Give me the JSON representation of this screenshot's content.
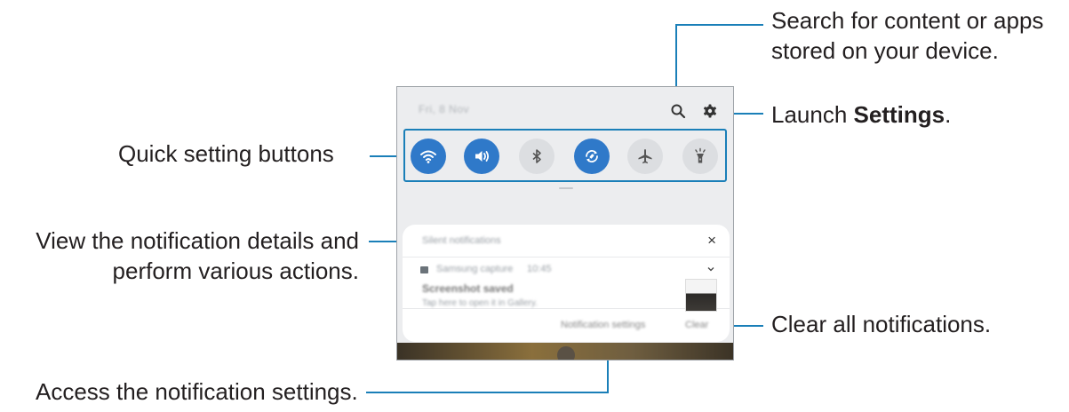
{
  "callouts": {
    "search_line1": "Search for content or apps",
    "search_line2": "stored on your device.",
    "settings_prefix": "Launch ",
    "settings_bold": "Settings",
    "settings_suffix": ".",
    "quick_settings": "Quick setting buttons",
    "notif_details_line1": "View the notification details and",
    "notif_details_line2": "perform various actions.",
    "clear_all": "Clear all notifications.",
    "notif_settings": "Access the notification settings."
  },
  "panel": {
    "datetime": "Fri, 8 Nov",
    "quick_buttons": [
      {
        "name": "wifi",
        "state": "on"
      },
      {
        "name": "sound",
        "state": "on"
      },
      {
        "name": "bluetooth",
        "state": "off"
      },
      {
        "name": "auto-rotate",
        "state": "on"
      },
      {
        "name": "airplane-mode",
        "state": "off"
      },
      {
        "name": "flashlight",
        "state": "off"
      }
    ],
    "card_header": "Silent notifications",
    "close_glyph": "×",
    "notification": {
      "app": "Samsung capture",
      "time": "10:45",
      "title": "Screenshot saved",
      "body": "Tap here to open it in Gallery."
    },
    "notification_settings_label": "Notification settings",
    "clear_label": "Clear"
  },
  "colors": {
    "accent": "#1a7fb8",
    "toggle_on": "#2f79c9",
    "toggle_off": "#dcdee1"
  }
}
